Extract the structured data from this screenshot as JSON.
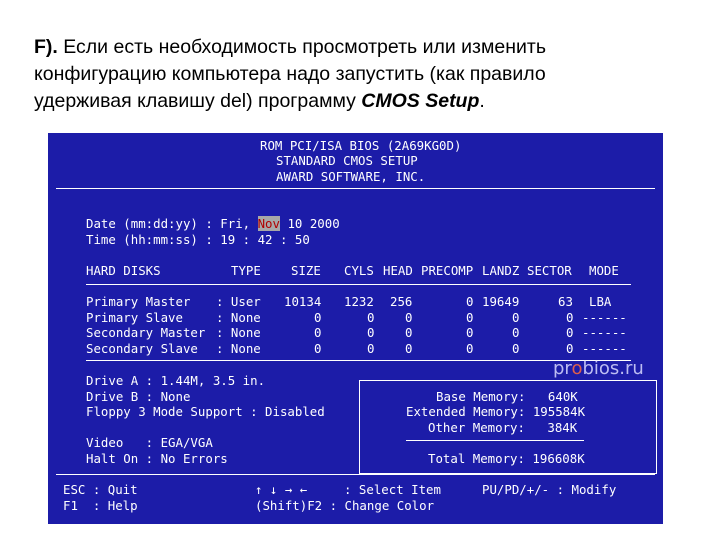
{
  "caption": {
    "prefix": "F).",
    "line1_rest": " Если есть необходимость просмотреть или изменить",
    "line2": "конфигурацию компьютера надо запустить (как правило",
    "line3_start": "удерживая клавишу del) программу ",
    "program": "CMOS Setup",
    "line3_end": "."
  },
  "bios": {
    "header": [
      "ROM PCI/ISA BIOS (2A69KG0D)",
      "STANDARD CMOS SETUP",
      "AWARD SOFTWARE, INC."
    ],
    "date_label": "Date (mm:dd:yy) : ",
    "date_prefix": "Fri, ",
    "date_month": "Nov",
    "date_rest": " 10 2000",
    "time_label": "Time (hh:mm:ss) : ",
    "time_value": "19 : 42 : 50",
    "disk_headers": [
      "HARD DISKS",
      "TYPE",
      "SIZE",
      "CYLS",
      "HEAD",
      "PRECOMP",
      "LANDZ",
      "SECTOR",
      "MODE"
    ],
    "disks": [
      [
        "Primary Master",
        ": User",
        "10134",
        "1232",
        "256",
        "0",
        "19649",
        "63",
        "LBA"
      ],
      [
        "Primary Slave",
        ": None",
        "0",
        "0",
        "0",
        "0",
        "0",
        "0",
        "------"
      ],
      [
        "Secondary Master",
        ": None",
        "0",
        "0",
        "0",
        "0",
        "0",
        "0",
        "------"
      ],
      [
        "Secondary Slave",
        ": None",
        "0",
        "0",
        "0",
        "0",
        "0",
        "0",
        "------"
      ]
    ],
    "drive_a": "Drive A : 1.44M, 3.5 in.",
    "drive_b": "Drive B : None",
    "floppy3": "Floppy 3 Mode Support : Disabled",
    "video": "Video   : EGA/VGA",
    "halt": "Halt On : No Errors",
    "memory": {
      "base": "Base Memory:   640K",
      "extended": "Extended Memory: 195584K",
      "other": "Other Memory:   384K",
      "total": "Total Memory: 196608K"
    },
    "footer": {
      "esc": "ESC : Quit",
      "f1": "F1  : Help",
      "arrows": "↑ ↓ → ←",
      "select": ": Select Item",
      "shift": "(Shift)F2 : Change Color",
      "modify": "PU/PD/+/- : Modify"
    }
  },
  "watermark": {
    "left": "pr",
    "o": "o",
    "right": "bios.ru"
  },
  "colors": {
    "bios_bg": "#1c1ca8",
    "highlight_text": "#b00000",
    "highlight_bg": "#a8a8a8"
  }
}
